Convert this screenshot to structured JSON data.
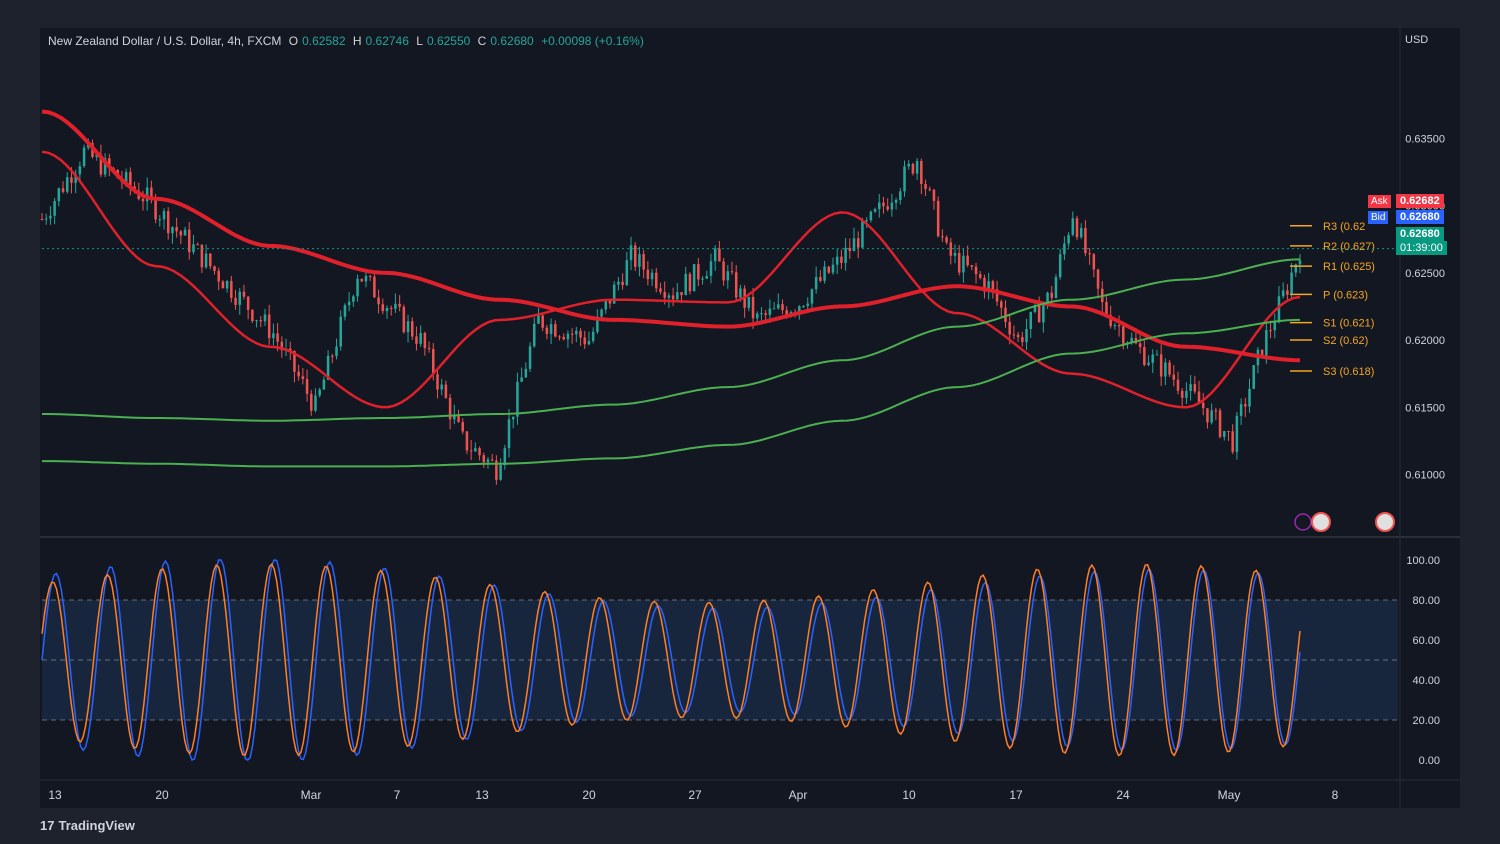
{
  "window": {
    "symbol_line": "New Zealand Dollar / U.S. Dollar, 4h, FXCM",
    "ohlc": {
      "o_label": "O",
      "o": "0.62582",
      "h_label": "H",
      "h": "0.62746",
      "l_label": "L",
      "l": "0.62550",
      "c_label": "C",
      "c": "0.62680",
      "change": "+0.00098 (+0.16%)"
    },
    "currency": "USD",
    "brand": "TradingView"
  },
  "price_scale": {
    "min": 0.6055,
    "max": 0.6412,
    "ticks": [
      "0.63500",
      "0.63000",
      "0.62500",
      "0.62000",
      "0.61500",
      "0.61000"
    ],
    "tick_values": [
      0.635,
      0.63,
      0.625,
      0.62,
      0.615,
      0.61
    ]
  },
  "tags": {
    "ask_label": "Ask",
    "ask": "0.62682",
    "bid_label": "Bid",
    "bid": "0.62680",
    "last": "0.62680",
    "countdown": "01:39:00"
  },
  "pivots": [
    {
      "label": "R3 (0.62",
      "value": 0.6285,
      "color": "#f5a623"
    },
    {
      "label": "R2 (0.627)",
      "value": 0.627,
      "color": "#f5a623"
    },
    {
      "label": "R1 (0.625)",
      "value": 0.6255,
      "color": "#f5a623"
    },
    {
      "label": "P (0.623)",
      "value": 0.6234,
      "color": "#f5a623"
    },
    {
      "label": "S1 (0.621)",
      "value": 0.6213,
      "color": "#f5a623"
    },
    {
      "label": "S2 (0.62)",
      "value": 0.62,
      "color": "#f5a623"
    },
    {
      "label": "S3 (0.618)",
      "value": 0.6177,
      "color": "#f5a623"
    }
  ],
  "time_axis": [
    "13",
    "20",
    "Mar",
    "7",
    "13",
    "20",
    "27",
    "Apr",
    "10",
    "17",
    "24",
    "May",
    "8"
  ],
  "oscillator": {
    "ticks": [
      "100.00",
      "80.00",
      "60.00",
      "40.00",
      "20.00",
      "0.00"
    ],
    "tick_values": [
      100,
      80,
      60,
      40,
      20,
      0
    ],
    "band": [
      20,
      80
    ],
    "mid": 50
  },
  "colors": {
    "up": "#26a69a",
    "down": "#ef5350",
    "ma_red": "#e0202a",
    "ma_green": "#4caf50",
    "k_line": "#2962ff",
    "d_line": "#ff7f27",
    "pivot": "#f5a623",
    "ask": "#f23645",
    "bid": "#2962ff",
    "last": "#089981"
  },
  "chart_data": [
    {
      "type": "line",
      "title": "New Zealand Dollar / U.S. Dollar, 4h, FXCM",
      "xlabel": "",
      "ylabel": "",
      "x": [
        "13",
        "20",
        "Mar",
        "7",
        "13",
        "20",
        "27",
        "Apr",
        "10",
        "17",
        "24",
        "May"
      ],
      "ylim": [
        0.6055,
        0.6412
      ],
      "series": [
        {
          "values": [
            0.634,
            0.6255,
            0.6195,
            0.615,
            0.6215,
            0.623,
            0.6228,
            0.6295,
            0.622,
            0.6175,
            0.615,
            0.6232
          ]
        },
        {
          "values": [
            0.637,
            0.6305,
            0.627,
            0.625,
            0.623,
            0.6215,
            0.621,
            0.6225,
            0.624,
            0.6225,
            0.6195,
            0.6185
          ]
        },
        {
          "values": [
            0.6145,
            0.6142,
            0.614,
            0.6142,
            0.6145,
            0.6152,
            0.6165,
            0.6185,
            0.621,
            0.623,
            0.6245,
            0.626
          ]
        },
        {
          "values": [
            0.611,
            0.6108,
            0.6106,
            0.6106,
            0.6108,
            0.6112,
            0.6122,
            0.614,
            0.6165,
            0.619,
            0.6205,
            0.6215
          ]
        }
      ]
    },
    {
      "type": "line",
      "title": "",
      "ylim": [
        0,
        100
      ],
      "x": [
        "13",
        "20",
        "Mar",
        "7",
        "13",
        "20",
        "27",
        "Apr",
        "10",
        "17",
        "24",
        "May"
      ],
      "series": [
        {
          "values": [
            30,
            95,
            20,
            95,
            10,
            98,
            5,
            95,
            35,
            92,
            15,
            90,
            55
          ]
        },
        {
          "values": [
            35,
            90,
            25,
            90,
            15,
            95,
            8,
            92,
            40,
            88,
            20,
            85,
            52
          ]
        }
      ]
    }
  ]
}
